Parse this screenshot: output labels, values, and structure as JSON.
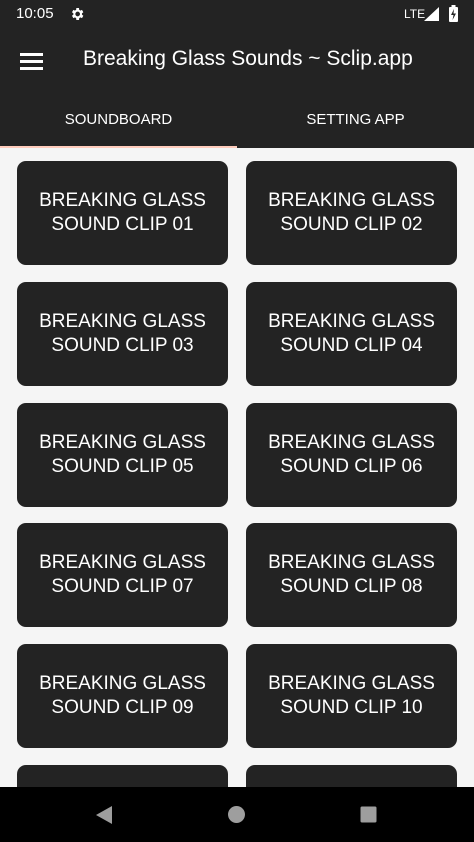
{
  "status_bar": {
    "time": "10:05",
    "network": "LTE",
    "icons": [
      "settings-gear-icon",
      "signal-icon",
      "battery-icon"
    ]
  },
  "app_bar": {
    "title": "Breaking Glass Sounds ~ Sclip.app",
    "menu_icon": "hamburger-menu-icon"
  },
  "tabs": [
    {
      "label": "SOUNDBOARD",
      "selected": true
    },
    {
      "label": "SETTING APP",
      "selected": false
    }
  ],
  "sound_buttons": [
    {
      "line1": "BREAKING GLASS",
      "line2": "SOUND CLIP 01"
    },
    {
      "line1": "BREAKING GLASS",
      "line2": "SOUND CLIP 02"
    },
    {
      "line1": "BREAKING GLASS",
      "line2": "SOUND CLIP 03"
    },
    {
      "line1": "BREAKING GLASS",
      "line2": "SOUND CLIP 04"
    },
    {
      "line1": "BREAKING GLASS",
      "line2": "SOUND CLIP 05"
    },
    {
      "line1": "BREAKING GLASS",
      "line2": "SOUND CLIP 06"
    },
    {
      "line1": "BREAKING GLASS",
      "line2": "SOUND CLIP 07"
    },
    {
      "line1": "BREAKING GLASS",
      "line2": "SOUND CLIP 08"
    },
    {
      "line1": "BREAKING GLASS",
      "line2": "SOUND CLIP 09"
    },
    {
      "line1": "BREAKING GLASS",
      "line2": "SOUND CLIP 10"
    }
  ],
  "colors": {
    "bar_background": "#232323",
    "tile_background": "#232323",
    "page_background": "#f5f5f5",
    "tab_indicator": "#ffccbc",
    "nav_background": "#000000"
  },
  "nav_bar": {
    "icons": [
      "back-icon",
      "home-icon",
      "recents-icon"
    ]
  }
}
